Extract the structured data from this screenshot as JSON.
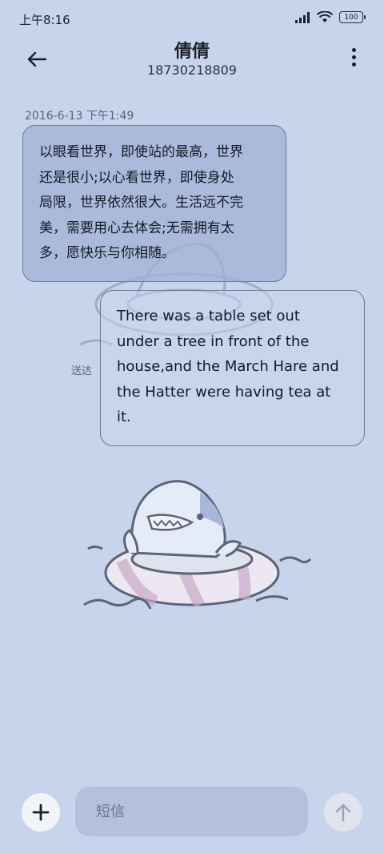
{
  "status_bar": {
    "time": "上午8:16",
    "battery": "100",
    "icons": [
      "signal-icon",
      "wifi-icon",
      "battery-icon"
    ]
  },
  "header": {
    "contact_name": "倩倩",
    "contact_number": "18730218809",
    "back_icon": "arrow-left-icon",
    "more_icon": "more-vertical-icon"
  },
  "conversation": {
    "timestamp": "2016-6-13 下午1:49",
    "messages": [
      {
        "direction": "incoming",
        "lines": [
          "以眼看世界，即使站的最高，世界",
          "还是很小;以心看世界，即使身处",
          "局限，世界依然很大。生活远不完",
          "美，需要用心去体会;无需拥有太",
          "多，愿快乐与你相随。"
        ]
      },
      {
        "direction": "outgoing",
        "status": "送达",
        "lines": [
          "There was a table set out",
          "under a tree in front of the",
          "house,and the March Hare and",
          "the Hatter were having tea at",
          "it."
        ]
      }
    ]
  },
  "composer": {
    "placeholder": "短信",
    "add_icon": "plus-icon",
    "send_icon": "arrow-up-icon"
  },
  "colors": {
    "background": "#c7d4ec",
    "incoming_bubble": "#a0b1d6",
    "input_field": "#b3c1dc"
  }
}
